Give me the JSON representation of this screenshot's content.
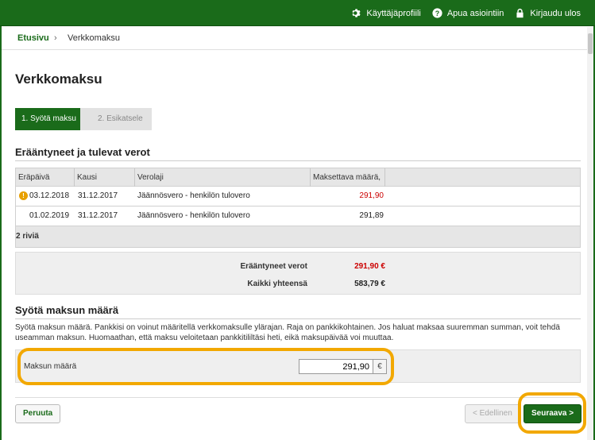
{
  "topbar": {
    "profile_label": "Käyttäjäprofiili",
    "help_label": "Apua asiointiin",
    "logout_label": "Kirjaudu ulos"
  },
  "breadcrumb": {
    "home": "Etusivu",
    "separator": "›",
    "current": "Verkkomaksu"
  },
  "page_title": "Verkkomaksu",
  "steps": [
    {
      "label": "1. Syötä maksu",
      "active": true
    },
    {
      "label": "2. Esikatsele",
      "active": false
    }
  ],
  "due_section": {
    "title": "Erääntyneet ja tulevat verot",
    "columns": [
      "Eräpäivä",
      "Kausi",
      "Verolaji",
      "Maksettava määrä,"
    ],
    "rows": [
      {
        "due_date": "03.12.2018",
        "period": "31.12.2017",
        "tax_type": "Jäännösvero - henkilön tulovero",
        "amount": "291,90",
        "overdue": true
      },
      {
        "due_date": "01.02.2019",
        "period": "31.12.2017",
        "tax_type": "Jäännösvero - henkilön tulovero",
        "amount": "291,89",
        "overdue": false
      }
    ],
    "row_count": "2 riviä",
    "overdue_label": "Erääntyneet verot",
    "overdue_total": "291,90 €",
    "total_label": "Kaikki yhteensä",
    "total": "583,79 €"
  },
  "payment_section": {
    "title": "Syötä maksun määrä",
    "info": "Syötä maksun määrä. Pankkisi on voinut määritellä verkkomaksulle ylärajan. Raja on pankkikohtainen. Jos haluat maksaa suuremman summan, voit tehdä useamman maksun. Huomaathan, että maksu veloitetaan pankkitililtäsi heti, eikä maksupäivää voi muuttaa.",
    "amount_label": "Maksun määrä",
    "amount_value": "291,90",
    "currency": "€"
  },
  "buttons": {
    "cancel": "Peruuta",
    "previous": "< Edellinen",
    "next": "Seuraava >"
  },
  "colors": {
    "brand_green": "#1a6b1a",
    "overdue_red": "#cc0000",
    "highlight": "#f2a800"
  }
}
